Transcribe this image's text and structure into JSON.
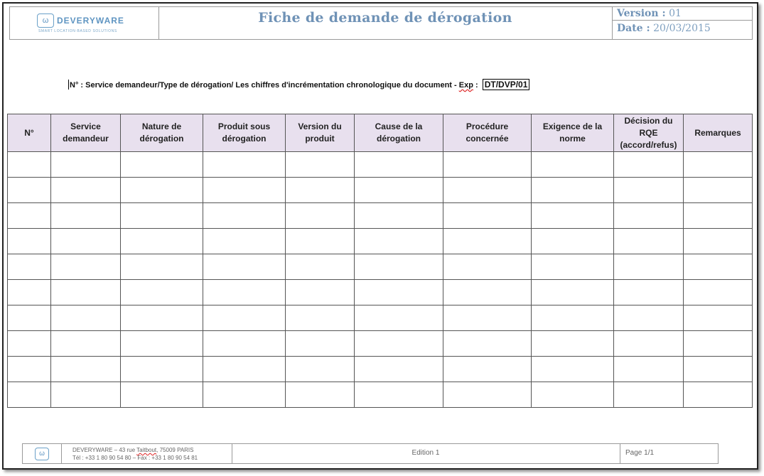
{
  "header": {
    "logo_text": "DEVERYWARE",
    "logo_tagline": "SMART LOCATION-BASED SOLUTIONS",
    "title": "Fiche de demande de dérogation",
    "version_label": "Version :",
    "version_value": "01",
    "date_label": "Date :",
    "date_value": "20/03/2015"
  },
  "reference": {
    "text": "N° : Service demandeur/Type de dérogation/ Les chiffres d'incrémentation chronologique du document - ",
    "exp_label": "Exp",
    "colon": " : ",
    "example": "DT/DVP/01"
  },
  "table": {
    "columns": [
      "N°",
      "Service demandeur",
      "Nature de dérogation",
      "Produit sous dérogation",
      "Version du produit",
      "Cause de la dérogation",
      "Procédure concernée",
      "Exigence de la norme",
      "Décision du RQE (accord/refus)",
      "Remarques"
    ],
    "rows": [
      [
        "",
        "",
        "",
        "",
        "",
        "",
        "",
        "",
        "",
        ""
      ],
      [
        "",
        "",
        "",
        "",
        "",
        "",
        "",
        "",
        "",
        ""
      ],
      [
        "",
        "",
        "",
        "",
        "",
        "",
        "",
        "",
        "",
        ""
      ],
      [
        "",
        "",
        "",
        "",
        "",
        "",
        "",
        "",
        "",
        ""
      ],
      [
        "",
        "",
        "",
        "",
        "",
        "",
        "",
        "",
        "",
        ""
      ],
      [
        "",
        "",
        "",
        "",
        "",
        "",
        "",
        "",
        "",
        ""
      ],
      [
        "",
        "",
        "",
        "",
        "",
        "",
        "",
        "",
        "",
        ""
      ],
      [
        "",
        "",
        "",
        "",
        "",
        "",
        "",
        "",
        "",
        ""
      ],
      [
        "",
        "",
        "",
        "",
        "",
        "",
        "",
        "",
        "",
        ""
      ],
      [
        "",
        "",
        "",
        "",
        "",
        "",
        "",
        "",
        "",
        ""
      ]
    ]
  },
  "footer": {
    "address_line1_prefix": "DEVERYWARE – 43 rue ",
    "address_line1_street": "Taitbout",
    "address_line1_suffix": ", 75009 PARIS",
    "address_line2": "Tél : +33 1 80 90 54 80 – Fax : +33 1 80 90 54 81",
    "edition": "Edition 1",
    "page": "Page 1/1"
  },
  "colors": {
    "title_blue": "#6f92b6",
    "header_fill": "#e8e0ee",
    "logo_blue": "#5f95c2"
  }
}
